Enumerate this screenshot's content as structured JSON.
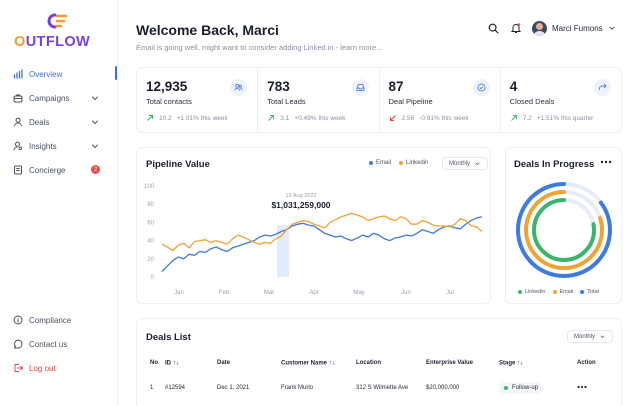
{
  "brand": {
    "name_prefix": "O",
    "name_rest": "UTFLOW",
    "colors": {
      "purple": "#7b3fe4",
      "orange": "#f39a2d"
    }
  },
  "sidebar": {
    "items": [
      {
        "label": "Overview",
        "icon": "bar-chart-icon",
        "active": true
      },
      {
        "label": "Campaigns",
        "icon": "briefcase-icon",
        "chevron": true
      },
      {
        "label": "Deals",
        "icon": "user-icon",
        "chevron": true
      },
      {
        "label": "Insights",
        "icon": "user-search-icon",
        "chevron": true
      },
      {
        "label": "Concierge",
        "icon": "document-icon",
        "badge": "2"
      }
    ],
    "bottom_items": [
      {
        "label": "Compliance",
        "icon": "info-circle-icon"
      },
      {
        "label": "Contact us",
        "icon": "chat-icon"
      },
      {
        "label": "Log out",
        "icon": "logout-icon"
      }
    ]
  },
  "header": {
    "title": "Welcome Back, Marci",
    "subtitle": "Email is going well, might want to consider adding Linked in  - learn more...",
    "user_name": "Marci Fumons"
  },
  "stats": [
    {
      "value": "12,935",
      "label": "Total contacts",
      "delta_num": "10.2",
      "delta_text": "+1.01% this week",
      "trend": "up",
      "icon": "users-icon"
    },
    {
      "value": "783",
      "label": "Total Leads",
      "delta_num": "3.1",
      "delta_text": "+0.49% this week",
      "trend": "up",
      "icon": "inbox-icon"
    },
    {
      "value": "87",
      "label": "Deal Pipeline",
      "delta_num": "2.56",
      "delta_text": "-0.91% this week",
      "trend": "down",
      "icon": "check-circle-icon"
    },
    {
      "value": "4",
      "label": "Closed Deals",
      "delta_num": "7.2",
      "delta_text": "+1.51% this quarter",
      "trend": "up",
      "icon": "share-icon"
    }
  ],
  "pipeline": {
    "title": "Pipeline Value",
    "legend": [
      "Email",
      "Linkedin"
    ],
    "period": "Monthly",
    "tooltip": {
      "date": "15 Aug 2022",
      "value": "$1,031,259,000"
    }
  },
  "chart_data": {
    "type": "line",
    "yticks": [
      0,
      20,
      40,
      60,
      80,
      100
    ],
    "ylim": [
      0,
      100
    ],
    "xticks": [
      "Jan",
      "Feb",
      "Mar",
      "Apr",
      "May",
      "Jun",
      "Jul"
    ],
    "series": [
      {
        "name": "Email",
        "color": "#3e7be0",
        "values": [
          6,
          12,
          18,
          22,
          20,
          25,
          24,
          28,
          27,
          31,
          33,
          30,
          28,
          32,
          34,
          36,
          38,
          40,
          44,
          46,
          45,
          47,
          50,
          52,
          56,
          58,
          59,
          57,
          56,
          52,
          48,
          46,
          44,
          45,
          42,
          40,
          43,
          46,
          44,
          48,
          46,
          42,
          40,
          43,
          44,
          46,
          45,
          48,
          52,
          50,
          48,
          52,
          55,
          56,
          54,
          53,
          58,
          62,
          65,
          66
        ]
      },
      {
        "name": "Linkedin",
        "color": "#f2a333",
        "values": [
          36,
          33,
          29,
          35,
          37,
          32,
          39,
          40,
          41,
          38,
          40,
          38,
          36,
          42,
          46,
          44,
          41,
          38,
          36,
          38,
          37,
          42,
          45,
          52,
          58,
          60,
          62,
          61,
          58,
          56,
          54,
          60,
          63,
          66,
          68,
          70,
          68,
          66,
          62,
          64,
          66,
          67,
          64,
          62,
          66,
          64,
          58,
          58,
          62,
          60,
          57,
          56,
          56,
          55,
          58,
          64,
          62,
          56,
          55,
          50
        ]
      }
    ]
  },
  "deals_progress": {
    "title": "Deals In Progress",
    "legend": [
      "Linkedin",
      "Email",
      "Total"
    ],
    "rings": [
      {
        "name": "Total",
        "color": "#3e7be0",
        "fraction": 0.85
      },
      {
        "name": "Email",
        "color": "#f2a333",
        "fraction": 0.8
      },
      {
        "name": "Linkedin",
        "color": "#3bb56c",
        "fraction": 0.78
      }
    ]
  },
  "deals_list": {
    "title": "Deals List",
    "period": "Monthly",
    "columns": [
      "No",
      "ID",
      "Date",
      "Customer Name",
      "Location",
      "Enterprise Value",
      "Stage",
      "Action"
    ],
    "rows": [
      {
        "no": "1",
        "id": "#12594",
        "date": "Dec 1, 2021",
        "customer": "Frank Murlo",
        "location": "312 S Wilmette Ave",
        "value": "$20,000,000",
        "stage": "Follow-up"
      }
    ]
  }
}
